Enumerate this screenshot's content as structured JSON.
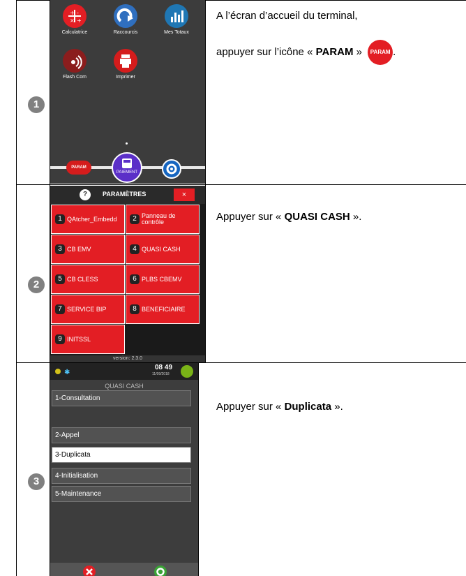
{
  "rows": [
    {
      "step": "1",
      "line1": "A l’écran d’accueil du terminal,",
      "line2_pre": "appuyer sur l’icône « ",
      "line2_bold": "PARAM",
      "line2_post": " »",
      "line2_end": ".",
      "inline_icon_label": "PARAM",
      "screen": {
        "apps": [
          "Calculatrice",
          "Raccourcis",
          "Mes Totaux",
          "Flash Com",
          "Imprimer"
        ],
        "dock_param": "PARAM",
        "dock_pay": "PAIEMENT"
      }
    },
    {
      "step": "2",
      "pre": "Appuyer sur « ",
      "bold": "QUASI CASH",
      "post": " ».",
      "screen": {
        "help": "?",
        "title": "PARAMÈTRES",
        "close": "×",
        "tiles": [
          {
            "n": "1",
            "label": "QAtcher_Embedd"
          },
          {
            "n": "2",
            "label": "Panneau de contrôle"
          },
          {
            "n": "3",
            "label": "CB EMV"
          },
          {
            "n": "4",
            "label": "QUASI CASH"
          },
          {
            "n": "5",
            "label": "CB CLESS"
          },
          {
            "n": "6",
            "label": "PLBS CBEMV"
          },
          {
            "n": "7",
            "label": "SERVICE BIP"
          },
          {
            "n": "8",
            "label": "BENEFICIAIRE"
          },
          {
            "n": "9",
            "label": "INITSSL"
          }
        ],
        "version": "version: 2.3.0"
      }
    },
    {
      "step": "3",
      "pre": "Appuyer sur « ",
      "bold": "Duplicata",
      "post": " ».",
      "screen": {
        "time": "08 49",
        "date": "11/09/2018",
        "title": "QUASI CASH",
        "items": [
          "1-Consultation",
          "2-Appel",
          "3-Duplicata",
          "4-Initialisation",
          "5-Maintenance"
        ],
        "selected_index": 2
      }
    }
  ],
  "colors": {
    "red": "#e31e24",
    "purple": "#5b2fc8",
    "blue": "#1565c0",
    "green": "#7ab317",
    "grey_bullet": "#808080"
  }
}
